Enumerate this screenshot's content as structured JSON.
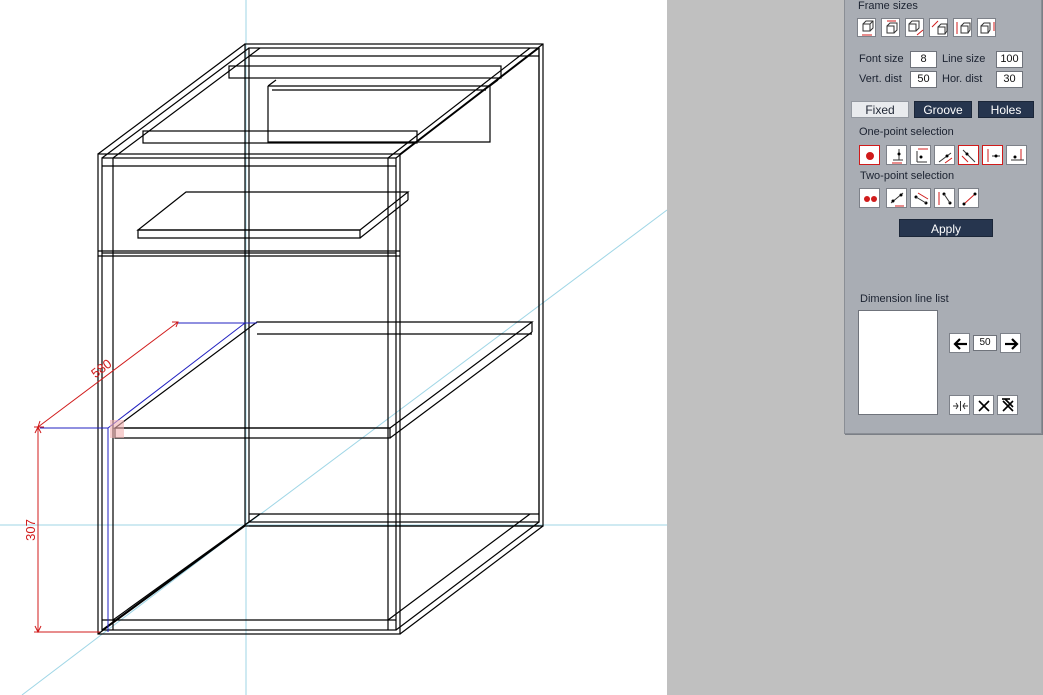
{
  "viewport": {
    "dimension_width": "580",
    "dimension_height": "307"
  },
  "panel": {
    "frame_sizes_title": "Frame sizes",
    "font_size_label": "Font size",
    "font_size_value": "8",
    "line_size_label": "Line size",
    "line_size_value": "100",
    "vert_dist_label": "Vert. dist",
    "vert_dist_value": "50",
    "hor_dist_label": "Hor. dist",
    "hor_dist_value": "30",
    "tabs": [
      "Fixed",
      "Groove",
      "Holes"
    ],
    "one_point_title": "One-point selection",
    "two_point_title": "Two-point selection",
    "apply_label": "Apply",
    "dimension_list_title": "Dimension line list",
    "step_value": "50"
  },
  "colors": {
    "panel_bg": "#a9adb4",
    "dark_button": "#26354e",
    "dimension_red": "#d01b1b",
    "axis_cyan": "#9fd6e6",
    "selection_blue": "#2020c0"
  }
}
